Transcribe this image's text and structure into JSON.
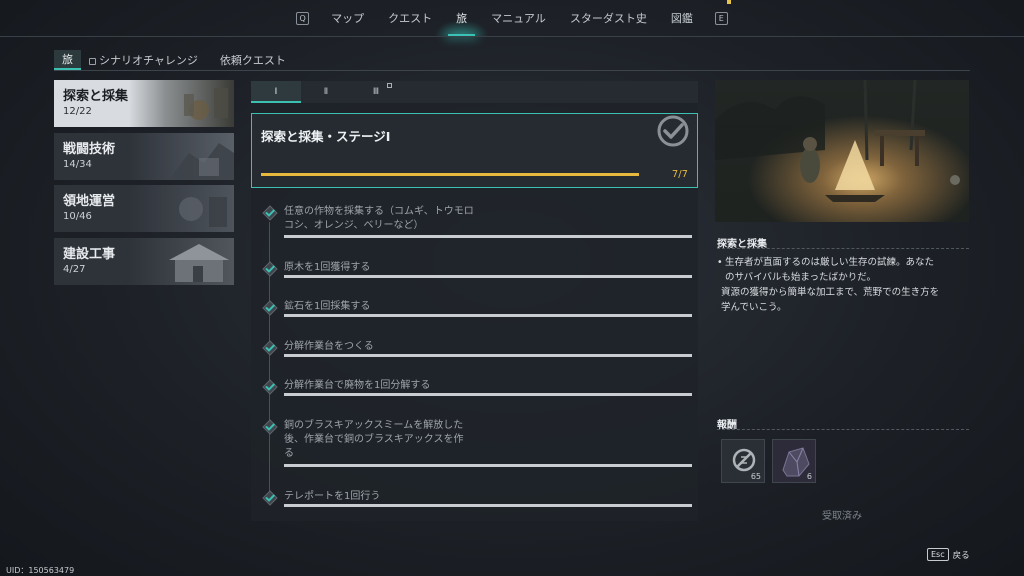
{
  "nav": {
    "left_key": "Q",
    "right_key": "E",
    "items": [
      {
        "label": "マップ"
      },
      {
        "label": "クエスト"
      },
      {
        "label": "旅"
      },
      {
        "label": "マニュアル"
      },
      {
        "label": "スターダスト史"
      },
      {
        "label": "図鑑"
      }
    ],
    "active_index": 2,
    "accent_color": "#3cc0b2"
  },
  "subtabs": [
    {
      "label": "旅"
    },
    {
      "label": "シナリオチャレンジ",
      "locked": true
    },
    {
      "label": "依頼クエスト"
    }
  ],
  "categories": [
    {
      "name": "探索と採集",
      "count": "12/22"
    },
    {
      "name": "戦闘技術",
      "count": "14/34"
    },
    {
      "name": "領地運営",
      "count": "10/46"
    },
    {
      "name": "建設工事",
      "count": "4/27"
    }
  ],
  "stage_tabs": [
    {
      "label": "Ⅰ"
    },
    {
      "label": "Ⅱ"
    },
    {
      "label": "Ⅲ",
      "locked": true
    }
  ],
  "stage": {
    "title": "探索と採集・ステージⅠ",
    "progress": "7/7",
    "progress_fraction": 1.0,
    "progress_color": "#e6b93e"
  },
  "tasks": [
    {
      "text_line1": "任意の作物を採集する（コムギ、トウモロ",
      "text_line2": "コシ、オレンジ、ベリーなど）",
      "done": true
    },
    {
      "text_line1": "原木を1回獲得する",
      "done": true
    },
    {
      "text_line1": "鉱石を1回採集する",
      "done": true
    },
    {
      "text_line1": "分解作業台をつくる",
      "done": true
    },
    {
      "text_line1": "分解作業台で廃物を1回分解する",
      "done": true
    },
    {
      "text_line1": "銅のブラスキアックスミームを解放した",
      "text_line2": "後、作業台で銅のブラスキアックスを作",
      "text_line3": "る",
      "done": true
    },
    {
      "text_line1": "テレポートを1回行う",
      "done": true
    }
  ],
  "detail": {
    "title": "探索と採集",
    "desc_line1": "生存者が直面するのは厳しい生存の試練。あなた",
    "desc_line2": "のサバイバルも始まったばかりだ。",
    "desc_line3": "資源の獲得から簡単な加工まで、荒野での生き方を",
    "desc_line4": "学んでいこう。"
  },
  "rewards": {
    "title": "報酬",
    "items": [
      {
        "icon": "coin-icon",
        "count": "65"
      },
      {
        "icon": "crystal-ore-icon",
        "count": "6"
      }
    ],
    "status": "受取済み"
  },
  "footer": {
    "esc_key": "Esc",
    "back_label": "戻る",
    "uid": "UID：150563479"
  }
}
